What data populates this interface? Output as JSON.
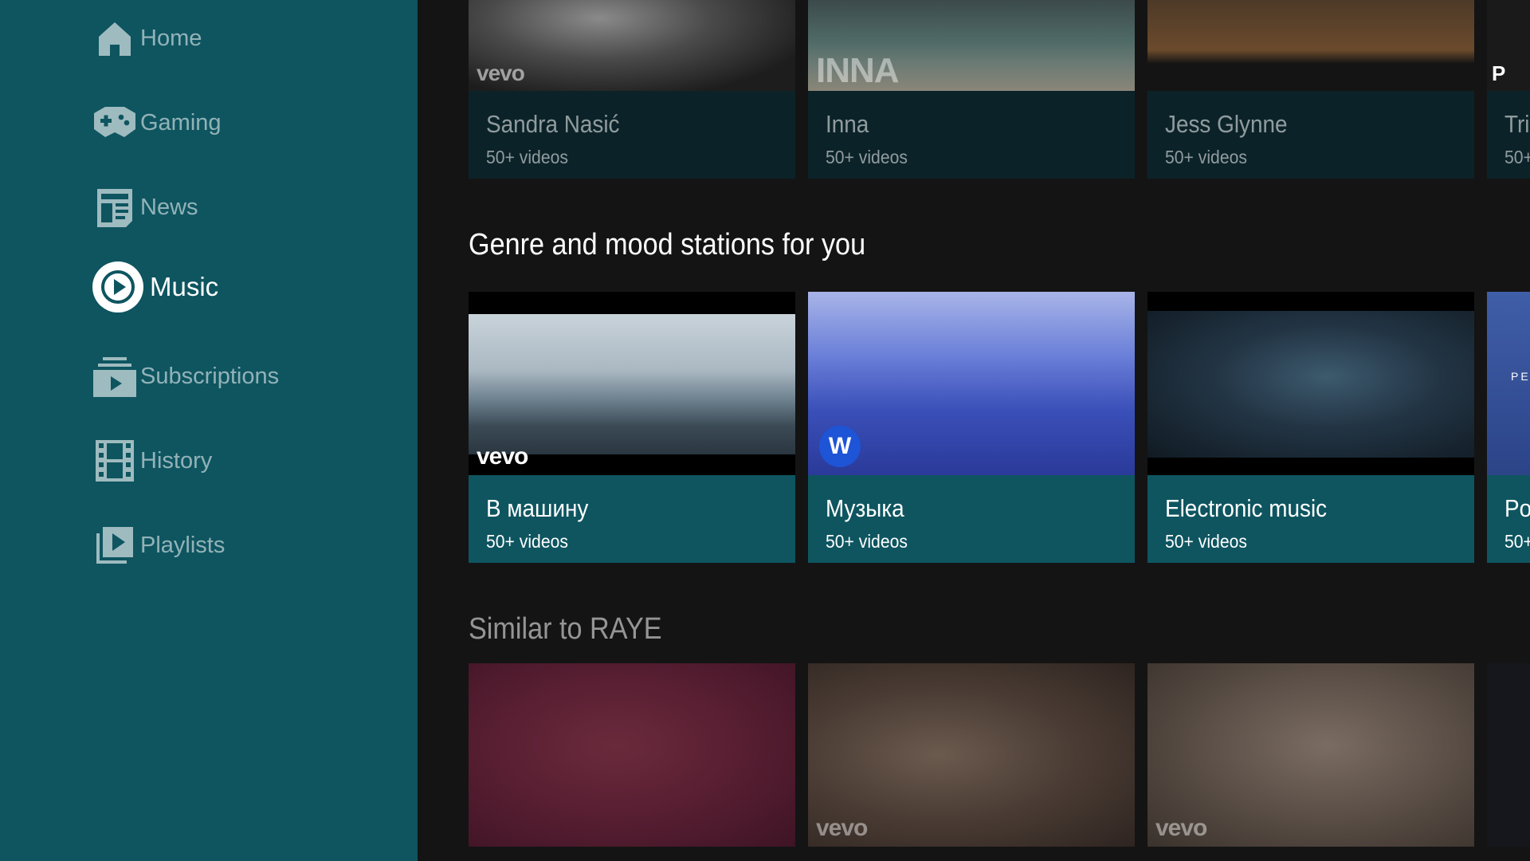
{
  "sidebar": {
    "items": [
      {
        "label": "Home",
        "icon": "home-icon",
        "active": false
      },
      {
        "label": "Gaming",
        "icon": "gamepad-icon",
        "active": false
      },
      {
        "label": "News",
        "icon": "newspaper-icon",
        "active": false
      },
      {
        "label": "Music",
        "icon": "music-play-icon",
        "active": true
      },
      {
        "label": "Subscriptions",
        "icon": "subscriptions-icon",
        "active": false
      },
      {
        "label": "History",
        "icon": "film-strip-icon",
        "active": false
      },
      {
        "label": "Playlists",
        "icon": "playlist-icon",
        "active": false
      }
    ]
  },
  "colors": {
    "sidebar_bg": "#0e5560",
    "page_bg": "#141414",
    "card_info_bright": "#0e5560",
    "card_info_dim": "#0b2328"
  },
  "rows": {
    "artists": {
      "cards": [
        {
          "title": "Sandra Nasić",
          "subtitle": "50+ videos",
          "watermark": "vevo"
        },
        {
          "title": "Inna",
          "subtitle": "50+ videos",
          "watermark": "INNA"
        },
        {
          "title": "Jess Glynne",
          "subtitle": "50+ videos",
          "watermark": ""
        },
        {
          "title": "Tri",
          "subtitle": "50+",
          "watermark": "P"
        }
      ]
    },
    "genre": {
      "title": "Genre and mood stations for you",
      "cards": [
        {
          "title": "В машину",
          "subtitle": "50+ videos",
          "watermark": "vevo"
        },
        {
          "title": "Музыка",
          "subtitle": "50+ videos",
          "watermark": "W"
        },
        {
          "title": "Electronic music",
          "subtitle": "50+ videos",
          "watermark": ""
        },
        {
          "title": "Po",
          "subtitle": "50+",
          "watermark": "PE"
        }
      ]
    },
    "similar": {
      "title": "Similar to RAYE",
      "cards": [
        {
          "watermark": ""
        },
        {
          "watermark": "vevo"
        },
        {
          "watermark": "vevo"
        },
        {
          "watermark": ""
        }
      ]
    }
  }
}
